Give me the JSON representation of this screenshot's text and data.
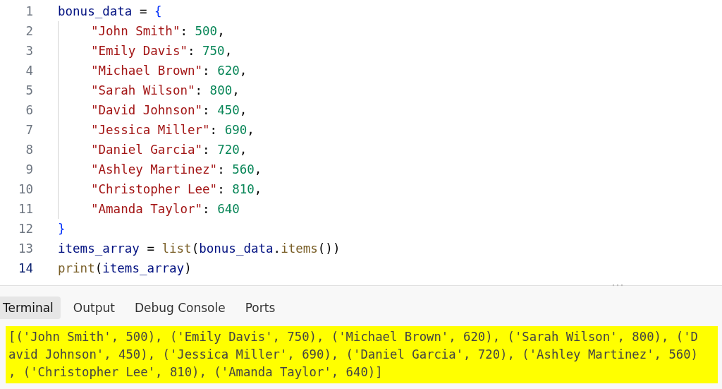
{
  "editor": {
    "lines": [
      {
        "number": "1",
        "current": false,
        "indent": false,
        "tokens": [
          {
            "kind": "var",
            "text": "bonus_data"
          },
          {
            "kind": "op",
            "text": " = "
          },
          {
            "kind": "brace",
            "text": "{"
          }
        ]
      },
      {
        "number": "2",
        "current": false,
        "indent": true,
        "tokens": [
          {
            "kind": "str",
            "text": "\"John Smith\""
          },
          {
            "kind": "op",
            "text": ": "
          },
          {
            "kind": "num",
            "text": "500"
          },
          {
            "kind": "op",
            "text": ","
          }
        ]
      },
      {
        "number": "3",
        "current": false,
        "indent": true,
        "tokens": [
          {
            "kind": "str",
            "text": "\"Emily Davis\""
          },
          {
            "kind": "op",
            "text": ": "
          },
          {
            "kind": "num",
            "text": "750"
          },
          {
            "kind": "op",
            "text": ","
          }
        ]
      },
      {
        "number": "4",
        "current": false,
        "indent": true,
        "tokens": [
          {
            "kind": "str",
            "text": "\"Michael Brown\""
          },
          {
            "kind": "op",
            "text": ": "
          },
          {
            "kind": "num",
            "text": "620"
          },
          {
            "kind": "op",
            "text": ","
          }
        ]
      },
      {
        "number": "5",
        "current": false,
        "indent": true,
        "tokens": [
          {
            "kind": "str",
            "text": "\"Sarah Wilson\""
          },
          {
            "kind": "op",
            "text": ": "
          },
          {
            "kind": "num",
            "text": "800"
          },
          {
            "kind": "op",
            "text": ","
          }
        ]
      },
      {
        "number": "6",
        "current": false,
        "indent": true,
        "tokens": [
          {
            "kind": "str",
            "text": "\"David Johnson\""
          },
          {
            "kind": "op",
            "text": ": "
          },
          {
            "kind": "num",
            "text": "450"
          },
          {
            "kind": "op",
            "text": ","
          }
        ]
      },
      {
        "number": "7",
        "current": false,
        "indent": true,
        "tokens": [
          {
            "kind": "str",
            "text": "\"Jessica Miller\""
          },
          {
            "kind": "op",
            "text": ": "
          },
          {
            "kind": "num",
            "text": "690"
          },
          {
            "kind": "op",
            "text": ","
          }
        ]
      },
      {
        "number": "8",
        "current": false,
        "indent": true,
        "tokens": [
          {
            "kind": "str",
            "text": "\"Daniel Garcia\""
          },
          {
            "kind": "op",
            "text": ": "
          },
          {
            "kind": "num",
            "text": "720"
          },
          {
            "kind": "op",
            "text": ","
          }
        ]
      },
      {
        "number": "9",
        "current": false,
        "indent": true,
        "tokens": [
          {
            "kind": "str",
            "text": "\"Ashley Martinez\""
          },
          {
            "kind": "op",
            "text": ": "
          },
          {
            "kind": "num",
            "text": "560"
          },
          {
            "kind": "op",
            "text": ","
          }
        ]
      },
      {
        "number": "10",
        "current": false,
        "indent": true,
        "tokens": [
          {
            "kind": "str",
            "text": "\"Christopher Lee\""
          },
          {
            "kind": "op",
            "text": ": "
          },
          {
            "kind": "num",
            "text": "810"
          },
          {
            "kind": "op",
            "text": ","
          }
        ]
      },
      {
        "number": "11",
        "current": false,
        "indent": true,
        "tokens": [
          {
            "kind": "str",
            "text": "\"Amanda Taylor\""
          },
          {
            "kind": "op",
            "text": ": "
          },
          {
            "kind": "num",
            "text": "640"
          }
        ]
      },
      {
        "number": "12",
        "current": false,
        "indent": false,
        "tokens": [
          {
            "kind": "brace",
            "text": "}"
          }
        ]
      },
      {
        "number": "13",
        "current": false,
        "indent": false,
        "tokens": [
          {
            "kind": "var",
            "text": "items_array"
          },
          {
            "kind": "op",
            "text": " = "
          },
          {
            "kind": "func",
            "text": "list"
          },
          {
            "kind": "op",
            "text": "("
          },
          {
            "kind": "var",
            "text": "bonus_data"
          },
          {
            "kind": "op",
            "text": "."
          },
          {
            "kind": "func",
            "text": "items"
          },
          {
            "kind": "op",
            "text": "())"
          }
        ]
      },
      {
        "number": "14",
        "current": true,
        "indent": false,
        "tokens": [
          {
            "kind": "func",
            "text": "print"
          },
          {
            "kind": "op",
            "text": "("
          },
          {
            "kind": "var",
            "text": "items_array"
          },
          {
            "kind": "op",
            "text": ")"
          }
        ]
      }
    ]
  },
  "panel": {
    "tabs": [
      {
        "label": "Terminal",
        "selected": true
      },
      {
        "label": "Output",
        "selected": false
      },
      {
        "label": "Debug Console",
        "selected": false
      },
      {
        "label": "Ports",
        "selected": false
      }
    ],
    "terminal_lines": [
      "[('John Smith', 500), ('Emily Davis', 750), ('Michael Brown', 620), ('Sarah Wilson', 800), ('D",
      "avid Johnson', 450), ('Jessica Miller', 690), ('Daniel Garcia', 720), ('Ashley Martinez', 560)",
      ", ('Christopher Lee', 810), ('Amanda Taylor', 640)]"
    ]
  }
}
